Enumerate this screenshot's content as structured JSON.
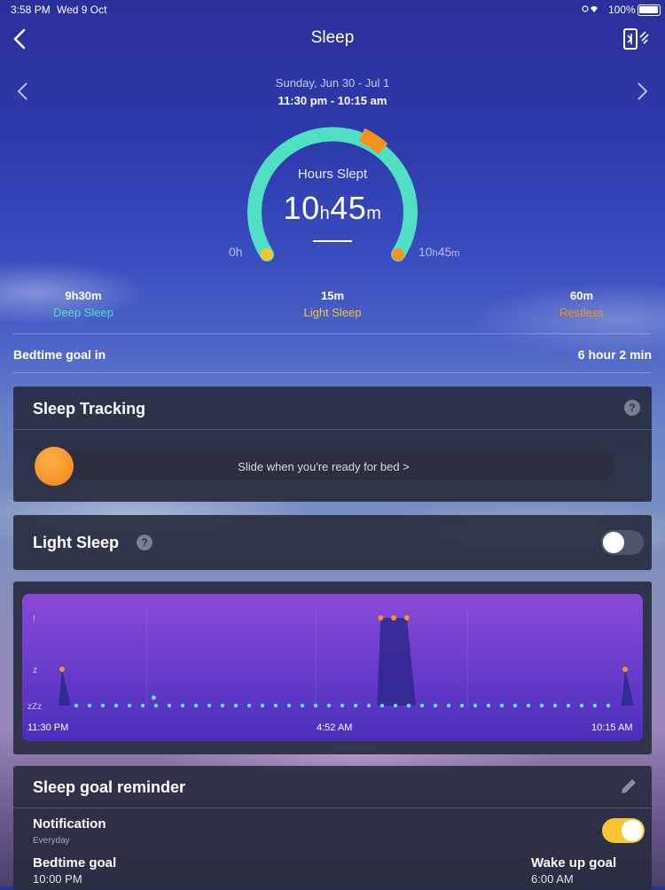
{
  "status_bar": {
    "time": "3:58 PM",
    "date": "Wed 9 Oct",
    "battery": "100%"
  },
  "nav": {
    "title": "Sleep",
    "back_icon": "chevron-left-icon",
    "action_icon": "phone-connect-icon"
  },
  "summary": {
    "date_range": "Sunday, Jun 30 - Jul 1",
    "time_range": "11:30 pm - 10:15 am",
    "hours_label": "Hours Slept",
    "hours_h": "10",
    "hours_h_unit": "h",
    "hours_m": "45",
    "hours_m_unit": "m",
    "gauge_min": "0h",
    "gauge_max_val": "10",
    "gauge_max_h": "h",
    "gauge_max_m": "45",
    "gauge_max_m_unit": "m",
    "colors": {
      "deep": "#4fe0c4",
      "light": "#f7c531",
      "restless": "#f6931e"
    }
  },
  "stats": [
    {
      "value": "9h30m",
      "label": "Deep Sleep",
      "color": "#4fe0c4"
    },
    {
      "value": "15m",
      "label": "Light Sleep",
      "color": "#f7c531"
    },
    {
      "value": "60m",
      "label": "Restless",
      "color": "#f6931e"
    }
  ],
  "bedtime": {
    "label": "Bedtime goal in",
    "value": "6 hour 2 min"
  },
  "tracking": {
    "title": "Sleep Tracking",
    "help": "?",
    "slider_text": "Slide when you're ready for bed >"
  },
  "light_sleep": {
    "title": "Light Sleep",
    "help": "?",
    "toggle_on": false
  },
  "chart": {
    "y_labels": [
      "!",
      "z",
      "zZz"
    ],
    "x_ticks": [
      "11:30 PM",
      "4:52 AM",
      "10:15 AM"
    ]
  },
  "chart_data": {
    "type": "area",
    "x_start": "11:30 PM",
    "x_end": "10:15 AM",
    "y_levels": [
      "zZz",
      "z",
      "!"
    ],
    "series": [
      {
        "values": [
          {
            "x": "11:30 PM",
            "y": "z"
          },
          {
            "x": "11:45 PM",
            "y": "zZz"
          },
          {
            "x": "1:00 AM",
            "y": "zZz"
          },
          {
            "x": "1:15 AM",
            "y": "zZz"
          },
          {
            "x": "1:30 AM",
            "y": "zZz"
          },
          {
            "x": "5:20 AM",
            "y": "zZz"
          },
          {
            "x": "5:35 AM",
            "y": "!"
          },
          {
            "x": "5:50 AM",
            "y": "!"
          },
          {
            "x": "6:05 AM",
            "y": "!"
          },
          {
            "x": "6:30 AM",
            "y": "zZz"
          },
          {
            "x": "10:00 AM",
            "y": "zZz"
          },
          {
            "x": "10:15 AM",
            "y": "z"
          }
        ]
      }
    ]
  },
  "reminder": {
    "title": "Sleep goal reminder",
    "edit_icon": "pencil-icon",
    "notification_label": "Notification",
    "notification_sub": "Everyday",
    "notification_on": true,
    "bedtime_label": "Bedtime goal",
    "bedtime_value": "10:00 PM",
    "wake_label": "Wake up goal",
    "wake_value": "6:00 AM"
  }
}
